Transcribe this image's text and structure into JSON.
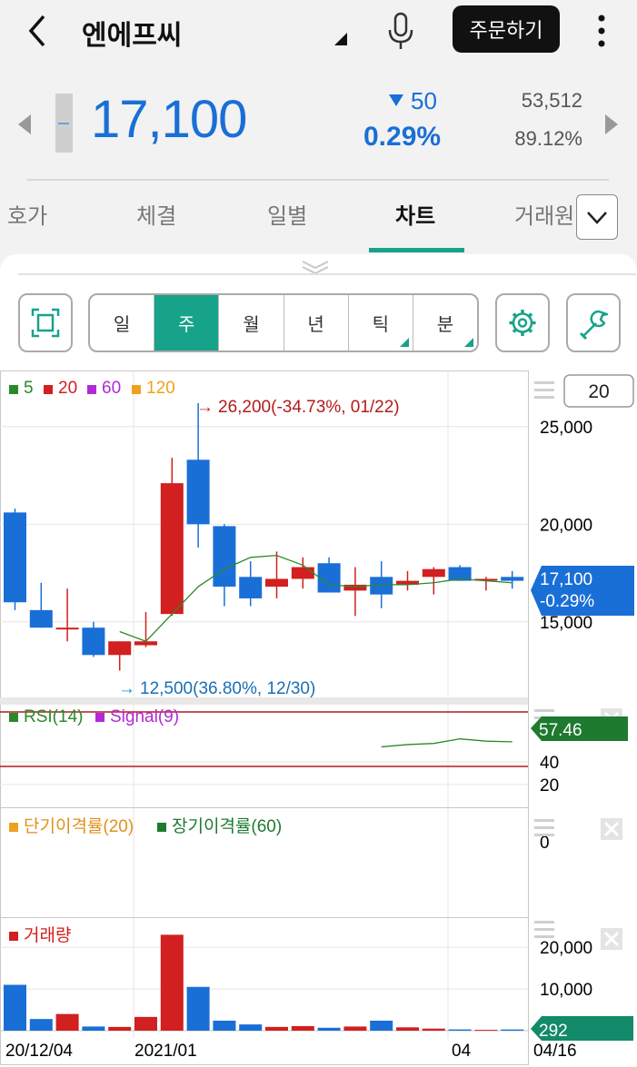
{
  "header": {
    "title": "엔에프씨",
    "order_button": "주문하기"
  },
  "quote": {
    "price": "17,100",
    "change": "50",
    "change_pct": "0.29%",
    "volume": "53,512",
    "turnover": "89.12%",
    "colors": {
      "down": "#1a6fd6",
      "up": "#d21f1f",
      "accent": "#17a38a"
    }
  },
  "tabs": [
    {
      "label": "호가"
    },
    {
      "label": "체결"
    },
    {
      "label": "일별"
    },
    {
      "label": "차트",
      "active": true
    },
    {
      "label": "거래원"
    }
  ],
  "period": {
    "options": [
      "일",
      "주",
      "월",
      "년",
      "틱",
      "분"
    ],
    "selected": "주"
  },
  "chart": {
    "count_box": "20",
    "legend": {
      "ma5": "5",
      "ma20": "20",
      "ma60": "60",
      "ma120": "120"
    },
    "high_note": "26,200(-34.73%, 01/22)",
    "low_note": "12,500(36.80%, 12/30)",
    "current_price": "17,100",
    "current_pct": "-0.29%",
    "rsi_legend": "RSI(14)",
    "signal_legend": "Signal(9)",
    "rsi_value": "57.46",
    "disparity_short": "단기이격률(20)",
    "disparity_long": "장기이격률(60)",
    "volume_legend": "거래량",
    "volume_value": "292",
    "x_labels": [
      "20/12/04",
      "2021/01",
      "04",
      "04/16"
    ]
  },
  "chart_data": [
    {
      "type": "candlestick",
      "title": "",
      "y_ticks": [
        "25,000",
        "20,000",
        "15,000"
      ],
      "ylim": [
        11500,
        27500
      ],
      "ohlc": [
        [
          20600,
          20800,
          15600,
          16000
        ],
        [
          15600,
          17000,
          14700,
          14700
        ],
        [
          14700,
          16700,
          14000,
          14700
        ],
        [
          14700,
          15000,
          13200,
          13300
        ],
        [
          13300,
          14000,
          12500,
          14000
        ],
        [
          13800,
          15500,
          13700,
          14000
        ],
        [
          15400,
          23400,
          15300,
          22100
        ],
        [
          23300,
          26200,
          18800,
          20000
        ],
        [
          19900,
          20000,
          15800,
          16800
        ],
        [
          17300,
          18100,
          15800,
          16200
        ],
        [
          16800,
          18600,
          16200,
          17200
        ],
        [
          17200,
          18300,
          16700,
          17800
        ],
        [
          18000,
          18300,
          16500,
          16500
        ],
        [
          16600,
          17800,
          15300,
          16900
        ],
        [
          17300,
          18100,
          15700,
          16400
        ],
        [
          16900,
          17600,
          16600,
          17100
        ],
        [
          17300,
          17800,
          16400,
          17700
        ],
        [
          17800,
          17900,
          17100,
          17100
        ],
        [
          17200,
          17300,
          16600,
          17200
        ],
        [
          17300,
          17600,
          16700,
          17100
        ]
      ],
      "ma5": [
        null,
        null,
        null,
        null,
        14500,
        14000,
        15400,
        16800,
        17700,
        18300,
        18400,
        17900,
        16900,
        16800,
        16900,
        16900,
        17000,
        17200,
        17100,
        17000
      ]
    },
    {
      "type": "line",
      "series": [
        {
          "name": "RSI(14)",
          "values": [
            null,
            null,
            null,
            null,
            null,
            null,
            null,
            null,
            null,
            null,
            null,
            null,
            null,
            null,
            53,
            55,
            56,
            60,
            58,
            57.46
          ]
        }
      ],
      "y_ticks": [
        "40",
        "20"
      ],
      "ylim": [
        0,
        90
      ]
    },
    {
      "type": "line",
      "series": [
        {
          "name": "단기이격률(20)",
          "values": []
        },
        {
          "name": "장기이격률(60)",
          "values": []
        }
      ],
      "y_ticks": [
        "0"
      ]
    },
    {
      "type": "bar",
      "series": [
        {
          "name": "거래량",
          "values": [
            11000,
            2800,
            4000,
            1000,
            900,
            3300,
            23000,
            10500,
            2400,
            1500,
            900,
            1100,
            700,
            1000,
            2400,
            800,
            500,
            300,
            200,
            292
          ]
        }
      ],
      "y_ticks": [
        "20,000",
        "10,000"
      ],
      "ylim": [
        0,
        27000
      ]
    }
  ]
}
